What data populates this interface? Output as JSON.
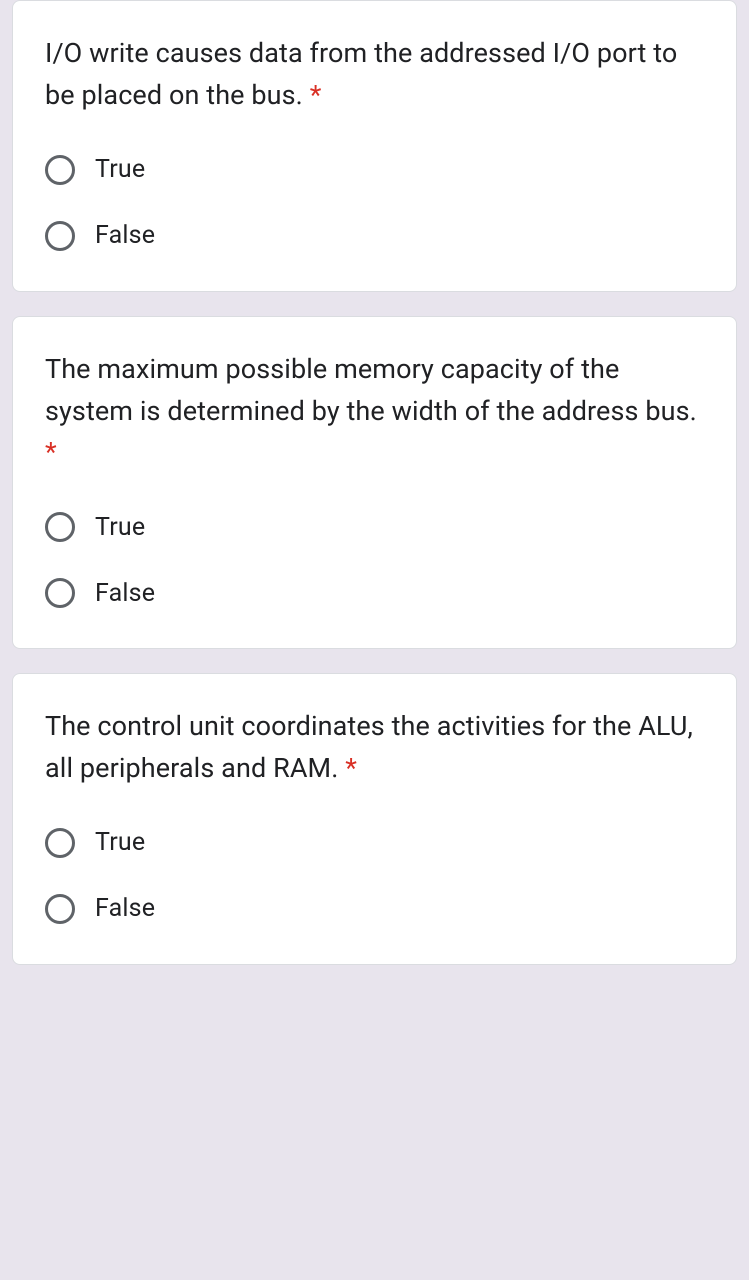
{
  "questions": [
    {
      "text": "I/O write causes data from the addressed I/O port to be placed on the bus.",
      "required": "*",
      "options": [
        {
          "label": "True"
        },
        {
          "label": "False"
        }
      ]
    },
    {
      "text": "The maximum possible memory capacity of the system is determined by the width of the address bus.",
      "required": "*",
      "options": [
        {
          "label": "True"
        },
        {
          "label": "False"
        }
      ]
    },
    {
      "text": "The control unit coordinates the activities for the ALU, all peripherals and RAM.",
      "required": "*",
      "options": [
        {
          "label": "True"
        },
        {
          "label": "False"
        }
      ]
    }
  ]
}
